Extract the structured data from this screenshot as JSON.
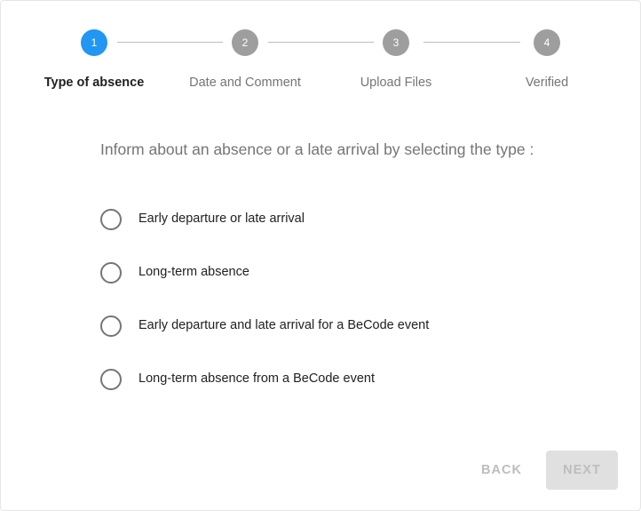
{
  "stepper": {
    "steps": [
      {
        "number": "1",
        "label": "Type of absence",
        "active": true
      },
      {
        "number": "2",
        "label": "Date and Comment",
        "active": false
      },
      {
        "number": "3",
        "label": "Upload Files",
        "active": false
      },
      {
        "number": "4",
        "label": "Verified",
        "active": false
      }
    ]
  },
  "form": {
    "prompt": "Inform about an absence or a late arrival by selecting the type :",
    "options": [
      {
        "label": "Early departure or late arrival",
        "selected": false
      },
      {
        "label": "Long-term absence",
        "selected": false
      },
      {
        "label": "Early departure and late arrival for a BeCode event",
        "selected": false
      },
      {
        "label": "Long-term absence from a BeCode event",
        "selected": false
      }
    ]
  },
  "actions": {
    "back_label": "BACK",
    "next_label": "NEXT"
  },
  "colors": {
    "active_step": "#2196f3",
    "inactive_step": "#9e9e9e",
    "radio_border": "#757575",
    "disabled_text": "#bdbdbd",
    "disabled_button_bg": "#e0e0e0"
  }
}
